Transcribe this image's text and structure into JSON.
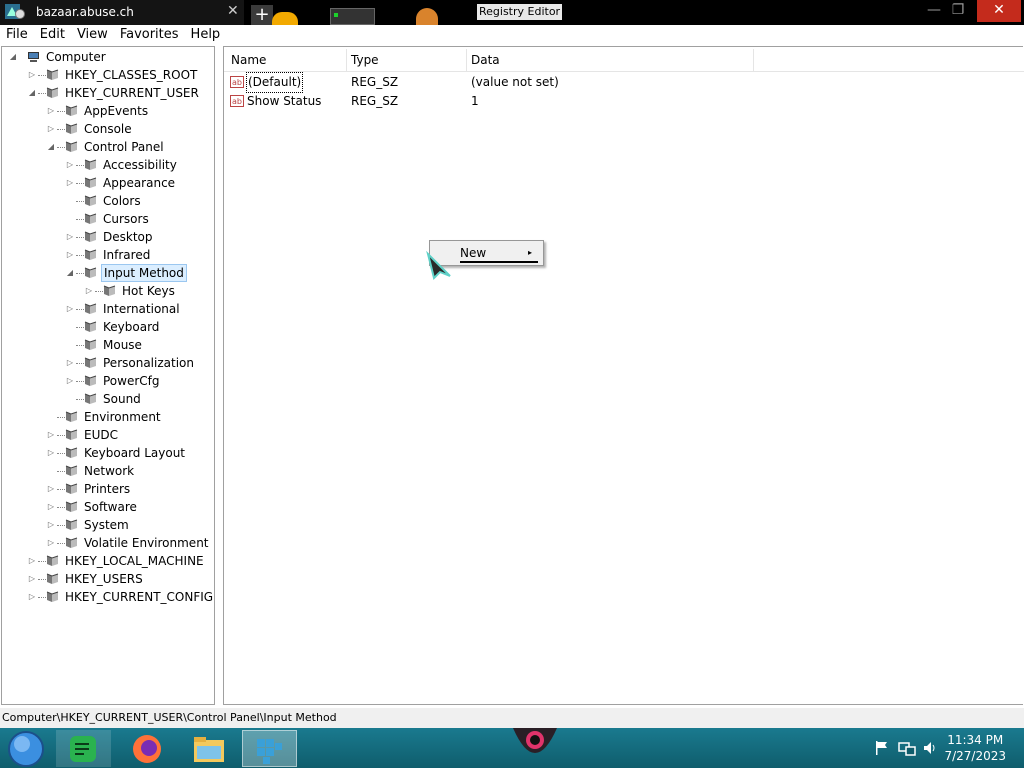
{
  "window": {
    "tab_title": "bazaar.abuse.ch",
    "tab_close": "✕",
    "new_tab": "+",
    "app_title": "Registry Editor",
    "minimize": "—",
    "maximize": "❐",
    "close": "✕"
  },
  "menu": {
    "items": [
      "File",
      "Edit",
      "View",
      "Favorites",
      "Help"
    ]
  },
  "tree": {
    "nodes": [
      {
        "label": "Computer",
        "level": 0,
        "expander": "open",
        "icon": "computer-icon"
      },
      {
        "label": "HKEY_CLASSES_ROOT",
        "level": 1,
        "expander": "closed"
      },
      {
        "label": "HKEY_CURRENT_USER",
        "level": 1,
        "expander": "open"
      },
      {
        "label": "AppEvents",
        "level": 2,
        "expander": "closed"
      },
      {
        "label": "Console",
        "level": 2,
        "expander": "closed"
      },
      {
        "label": "Control Panel",
        "level": 2,
        "expander": "open"
      },
      {
        "label": "Accessibility",
        "level": 3,
        "expander": "closed"
      },
      {
        "label": "Appearance",
        "level": 3,
        "expander": "closed"
      },
      {
        "label": "Colors",
        "level": 3,
        "expander": "none"
      },
      {
        "label": "Cursors",
        "level": 3,
        "expander": "none"
      },
      {
        "label": "Desktop",
        "level": 3,
        "expander": "closed"
      },
      {
        "label": "Infrared",
        "level": 3,
        "expander": "closed"
      },
      {
        "label": "Input Method",
        "level": 3,
        "expander": "open",
        "selected": true
      },
      {
        "label": "Hot Keys",
        "level": 4,
        "expander": "closed"
      },
      {
        "label": "International",
        "level": 3,
        "expander": "closed"
      },
      {
        "label": "Keyboard",
        "level": 3,
        "expander": "none"
      },
      {
        "label": "Mouse",
        "level": 3,
        "expander": "none"
      },
      {
        "label": "Personalization",
        "level": 3,
        "expander": "closed"
      },
      {
        "label": "PowerCfg",
        "level": 3,
        "expander": "closed"
      },
      {
        "label": "Sound",
        "level": 3,
        "expander": "none"
      },
      {
        "label": "Environment",
        "level": 2,
        "expander": "none"
      },
      {
        "label": "EUDC",
        "level": 2,
        "expander": "closed"
      },
      {
        "label": "Keyboard Layout",
        "level": 2,
        "expander": "closed"
      },
      {
        "label": "Network",
        "level": 2,
        "expander": "none"
      },
      {
        "label": "Printers",
        "level": 2,
        "expander": "closed"
      },
      {
        "label": "Software",
        "level": 2,
        "expander": "closed"
      },
      {
        "label": "System",
        "level": 2,
        "expander": "closed"
      },
      {
        "label": "Volatile Environment",
        "level": 2,
        "expander": "closed"
      },
      {
        "label": "HKEY_LOCAL_MACHINE",
        "level": 1,
        "expander": "closed"
      },
      {
        "label": "HKEY_USERS",
        "level": 1,
        "expander": "closed"
      },
      {
        "label": "HKEY_CURRENT_CONFIG",
        "level": 1,
        "expander": "closed"
      }
    ]
  },
  "list": {
    "columns": [
      "Name",
      "Type",
      "Data"
    ],
    "rows": [
      {
        "name": "(Default)",
        "type": "REG_SZ",
        "data": "(value not set)",
        "icon_text": "ab"
      },
      {
        "name": "Show Status",
        "type": "REG_SZ",
        "data": "1",
        "icon_text": "ab"
      }
    ]
  },
  "context_menu": {
    "items": [
      {
        "label": "New",
        "submenu_arrow": "▸"
      }
    ]
  },
  "statusbar": {
    "path": "Computer\\HKEY_CURRENT_USER\\Control Panel\\Input Method"
  },
  "taskbar": {
    "time": "11:34 PM",
    "date": "7/27/2023",
    "apps": [
      "start-orb-icon",
      "notes-app-icon",
      "firefox-icon",
      "file-explorer-icon",
      "registry-editor-icon"
    ],
    "tray": [
      "action-center-flag-icon",
      "network-icon",
      "volume-icon"
    ]
  },
  "colors": {
    "close_button": "#c42b1c",
    "selection": "#dbeeff",
    "taskbar": "#1a7a8f",
    "folder": "#d9b44a"
  }
}
